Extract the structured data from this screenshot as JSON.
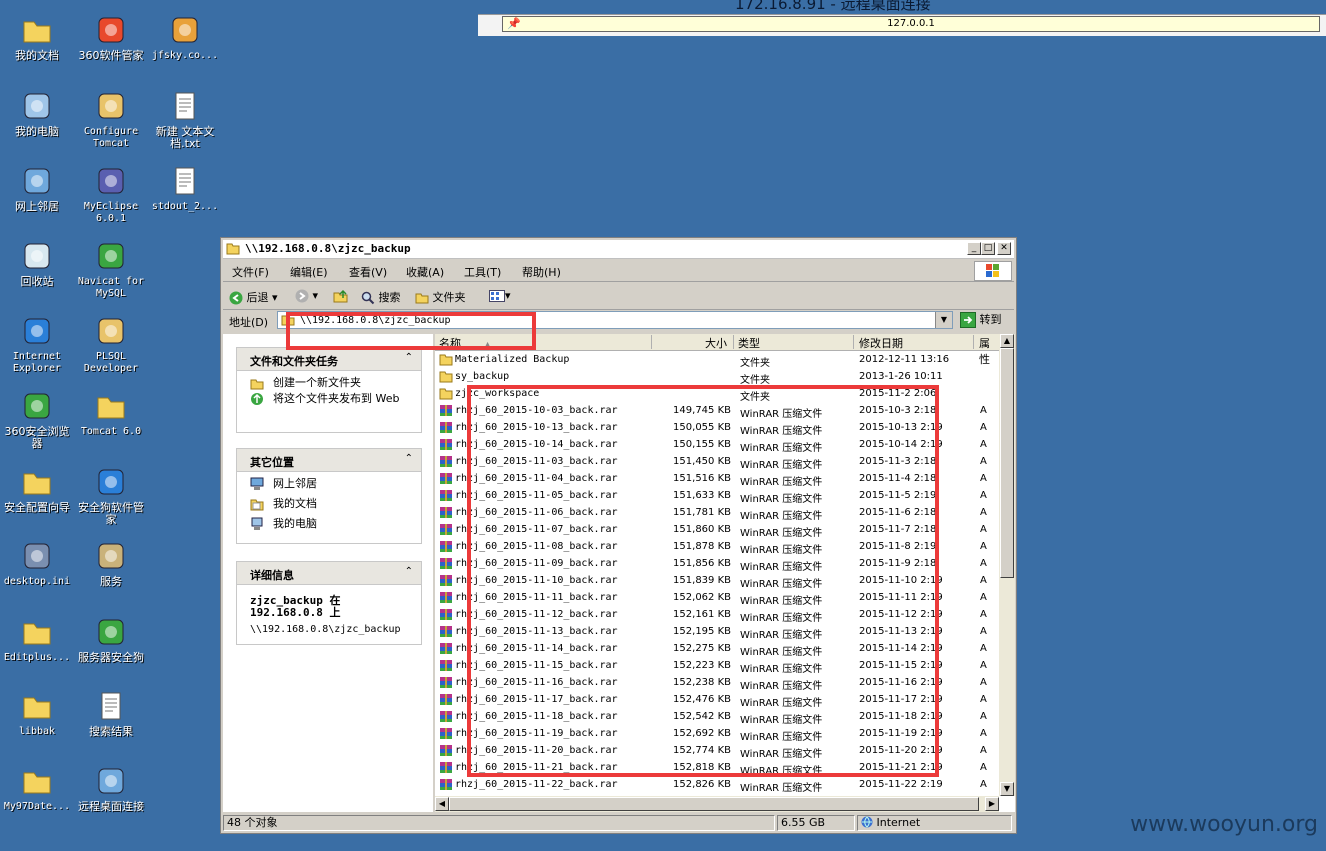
{
  "rdp": {
    "title": "172.16.8.91 - 远程桌面连接",
    "host": "127.0.0.1"
  },
  "desktop_icons": [
    {
      "name": "mydocs",
      "label": "我的文档"
    },
    {
      "name": "360-manager",
      "label": "360软件管家"
    },
    {
      "name": "jfsky",
      "label": "jfsky.co..."
    },
    {
      "name": "mycomputer",
      "label": "我的电脑"
    },
    {
      "name": "configure-tomcat",
      "label": "Configure Tomcat"
    },
    {
      "name": "new-text",
      "label": "新建 文本文档.txt"
    },
    {
      "name": "network",
      "label": "网上邻居"
    },
    {
      "name": "myeclipse",
      "label": "MyEclipse 6.0.1"
    },
    {
      "name": "stdout",
      "label": "stdout_2..."
    },
    {
      "name": "recycle-bin",
      "label": "回收站"
    },
    {
      "name": "navicat",
      "label": "Navicat for MySQL"
    },
    {
      "name": "ie",
      "label": "Internet Explorer"
    },
    {
      "name": "plsql",
      "label": "PLSQL Developer"
    },
    {
      "name": "360-browser",
      "label": "360安全浏览器"
    },
    {
      "name": "tomcat6",
      "label": "Tomcat 6.0"
    },
    {
      "name": "security-wizard",
      "label": "安全配置向导"
    },
    {
      "name": "security-dog-mgr",
      "label": "安全狗软件管家"
    },
    {
      "name": "desktop-ini",
      "label": "desktop.ini"
    },
    {
      "name": "services",
      "label": "服务"
    },
    {
      "name": "editplus",
      "label": "Editplus..."
    },
    {
      "name": "server-dog",
      "label": "服务器安全狗"
    },
    {
      "name": "libbak",
      "label": "libbak"
    },
    {
      "name": "search-results",
      "label": "搜索结果"
    },
    {
      "name": "my97date",
      "label": "My97Date..."
    },
    {
      "name": "remote-desktop",
      "label": "远程桌面连接"
    }
  ],
  "window": {
    "title": "\\\\192.168.0.8\\zjzc_backup",
    "menu": [
      "文件(F)",
      "编辑(E)",
      "查看(V)",
      "收藏(A)",
      "工具(T)",
      "帮助(H)"
    ],
    "toolbar": {
      "back": "后退",
      "search": "搜索",
      "folders": "文件夹"
    },
    "address_label": "地址(D)",
    "address_value": "\\\\192.168.0.8\\zjzc_backup",
    "goto_label": "转到"
  },
  "tasks_panel": {
    "title": "文件和文件夹任务",
    "items": [
      "创建一个新文件夹",
      "将这个文件夹发布到 Web"
    ]
  },
  "places_panel": {
    "title": "其它位置",
    "items": [
      "网上邻居",
      "我的文档",
      "我的电脑"
    ]
  },
  "details_panel": {
    "title": "详细信息",
    "heading": "zjzc_backup 在 192.168.0.8 上",
    "path": "\\\\192.168.0.8\\zjzc_backup"
  },
  "columns": [
    "名称",
    "大小",
    "类型",
    "修改日期",
    "属性"
  ],
  "files": [
    {
      "name": "Materialized Backup",
      "size": "",
      "type": "文件夹",
      "date": "2012-12-11 13:16",
      "attr": "",
      "kind": "folder"
    },
    {
      "name": "sy_backup",
      "size": "",
      "type": "文件夹",
      "date": "2013-1-26 10:11",
      "attr": "",
      "kind": "folder"
    },
    {
      "name": "zjzc_workspace",
      "size": "",
      "type": "文件夹",
      "date": "2015-11-2 2:06",
      "attr": "",
      "kind": "folder"
    },
    {
      "name": "rhzj_60_2015-10-03_back.rar",
      "size": "149,745 KB",
      "type": "WinRAR 压缩文件",
      "date": "2015-10-3 2:18",
      "attr": "A",
      "kind": "rar"
    },
    {
      "name": "rhzj_60_2015-10-13_back.rar",
      "size": "150,055 KB",
      "type": "WinRAR 压缩文件",
      "date": "2015-10-13 2:19",
      "attr": "A",
      "kind": "rar"
    },
    {
      "name": "rhzj_60_2015-10-14_back.rar",
      "size": "150,155 KB",
      "type": "WinRAR 压缩文件",
      "date": "2015-10-14 2:19",
      "attr": "A",
      "kind": "rar"
    },
    {
      "name": "rhzj_60_2015-11-03_back.rar",
      "size": "151,450 KB",
      "type": "WinRAR 压缩文件",
      "date": "2015-11-3 2:18",
      "attr": "A",
      "kind": "rar"
    },
    {
      "name": "rhzj_60_2015-11-04_back.rar",
      "size": "151,516 KB",
      "type": "WinRAR 压缩文件",
      "date": "2015-11-4 2:18",
      "attr": "A",
      "kind": "rar"
    },
    {
      "name": "rhzj_60_2015-11-05_back.rar",
      "size": "151,633 KB",
      "type": "WinRAR 压缩文件",
      "date": "2015-11-5 2:19",
      "attr": "A",
      "kind": "rar"
    },
    {
      "name": "rhzj_60_2015-11-06_back.rar",
      "size": "151,781 KB",
      "type": "WinRAR 压缩文件",
      "date": "2015-11-6 2:18",
      "attr": "A",
      "kind": "rar"
    },
    {
      "name": "rhzj_60_2015-11-07_back.rar",
      "size": "151,860 KB",
      "type": "WinRAR 压缩文件",
      "date": "2015-11-7 2:18",
      "attr": "A",
      "kind": "rar"
    },
    {
      "name": "rhzj_60_2015-11-08_back.rar",
      "size": "151,878 KB",
      "type": "WinRAR 压缩文件",
      "date": "2015-11-8 2:19",
      "attr": "A",
      "kind": "rar"
    },
    {
      "name": "rhzj_60_2015-11-09_back.rar",
      "size": "151,856 KB",
      "type": "WinRAR 压缩文件",
      "date": "2015-11-9 2:18",
      "attr": "A",
      "kind": "rar"
    },
    {
      "name": "rhzj_60_2015-11-10_back.rar",
      "size": "151,839 KB",
      "type": "WinRAR 压缩文件",
      "date": "2015-11-10 2:19",
      "attr": "A",
      "kind": "rar"
    },
    {
      "name": "rhzj_60_2015-11-11_back.rar",
      "size": "152,062 KB",
      "type": "WinRAR 压缩文件",
      "date": "2015-11-11 2:19",
      "attr": "A",
      "kind": "rar"
    },
    {
      "name": "rhzj_60_2015-11-12_back.rar",
      "size": "152,161 KB",
      "type": "WinRAR 压缩文件",
      "date": "2015-11-12 2:19",
      "attr": "A",
      "kind": "rar"
    },
    {
      "name": "rhzj_60_2015-11-13_back.rar",
      "size": "152,195 KB",
      "type": "WinRAR 压缩文件",
      "date": "2015-11-13 2:19",
      "attr": "A",
      "kind": "rar"
    },
    {
      "name": "rhzj_60_2015-11-14_back.rar",
      "size": "152,275 KB",
      "type": "WinRAR 压缩文件",
      "date": "2015-11-14 2:19",
      "attr": "A",
      "kind": "rar"
    },
    {
      "name": "rhzj_60_2015-11-15_back.rar",
      "size": "152,223 KB",
      "type": "WinRAR 压缩文件",
      "date": "2015-11-15 2:19",
      "attr": "A",
      "kind": "rar"
    },
    {
      "name": "rhzj_60_2015-11-16_back.rar",
      "size": "152,238 KB",
      "type": "WinRAR 压缩文件",
      "date": "2015-11-16 2:19",
      "attr": "A",
      "kind": "rar"
    },
    {
      "name": "rhzj_60_2015-11-17_back.rar",
      "size": "152,476 KB",
      "type": "WinRAR 压缩文件",
      "date": "2015-11-17 2:19",
      "attr": "A",
      "kind": "rar"
    },
    {
      "name": "rhzj_60_2015-11-18_back.rar",
      "size": "152,542 KB",
      "type": "WinRAR 压缩文件",
      "date": "2015-11-18 2:19",
      "attr": "A",
      "kind": "rar"
    },
    {
      "name": "rhzj_60_2015-11-19_back.rar",
      "size": "152,692 KB",
      "type": "WinRAR 压缩文件",
      "date": "2015-11-19 2:19",
      "attr": "A",
      "kind": "rar"
    },
    {
      "name": "rhzj_60_2015-11-20_back.rar",
      "size": "152,774 KB",
      "type": "WinRAR 压缩文件",
      "date": "2015-11-20 2:19",
      "attr": "A",
      "kind": "rar"
    },
    {
      "name": "rhzj_60_2015-11-21_back.rar",
      "size": "152,818 KB",
      "type": "WinRAR 压缩文件",
      "date": "2015-11-21 2:19",
      "attr": "A",
      "kind": "rar"
    },
    {
      "name": "rhzj_60_2015-11-22_back.rar",
      "size": "152,826 KB",
      "type": "WinRAR 压缩文件",
      "date": "2015-11-22 2:19",
      "attr": "A",
      "kind": "rar"
    }
  ],
  "status": {
    "count": "48 个对象",
    "size": "6.55 GB",
    "zone": "Internet"
  },
  "watermark": "www.wooyun.org",
  "colors": {
    "desktop": "#3a6ea5",
    "highlight_box": "#ec3a3a",
    "folder": "#f4d35e",
    "rar_a": "#b5338a",
    "rar_b": "#2d62c9",
    "rar_c": "#3aa641"
  }
}
